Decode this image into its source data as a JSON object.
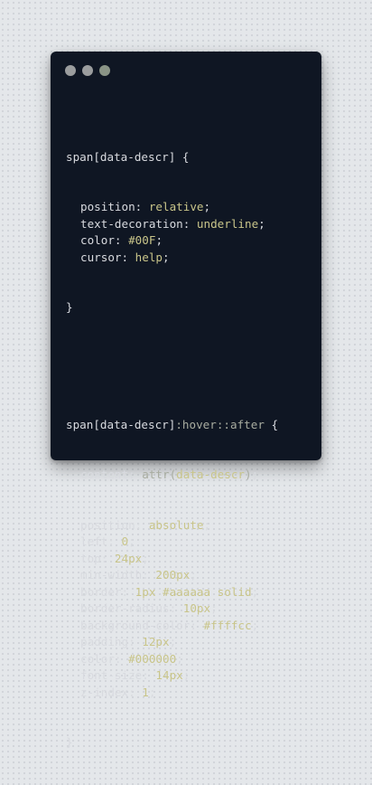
{
  "code": {
    "rule1": {
      "selector": "span[data-descr]",
      "open": " {",
      "declarations": [
        {
          "prop": "position",
          "value": "relative"
        },
        {
          "prop": "text-decoration",
          "value": "underline"
        },
        {
          "prop": "color",
          "value": "#00F"
        },
        {
          "prop": "cursor",
          "value": "help"
        }
      ],
      "close": "}"
    },
    "rule2": {
      "selector": "span[data-descr]",
      "pseudo": ":hover::after",
      "open": " {",
      "content_prop": "content",
      "content_fn": "attr(",
      "content_arg": "data-descr",
      "content_close": ")",
      "declarations": [
        {
          "prop": "position",
          "value": "absolute"
        },
        {
          "prop": "left",
          "value": "0"
        },
        {
          "prop": "top",
          "value": "24px"
        },
        {
          "prop": "min-width",
          "value": "200px"
        },
        {
          "prop": "border",
          "value": "1px #aaaaaa solid"
        },
        {
          "prop": "border-radius",
          "value": "10px"
        },
        {
          "prop": "background-color",
          "value": "#ffffcc"
        },
        {
          "prop": "padding",
          "value": "12px"
        },
        {
          "prop": "color",
          "value": "#000000"
        },
        {
          "prop": "font-size",
          "value": "14px"
        },
        {
          "prop": "z-index",
          "value": "1"
        }
      ],
      "close": "}"
    }
  },
  "colors": {
    "window_bg": "#0f1623",
    "text": "#d8dadf",
    "value": "#c9c58a",
    "pseudo": "#a8aca0",
    "dot": "#9b9d9e"
  }
}
